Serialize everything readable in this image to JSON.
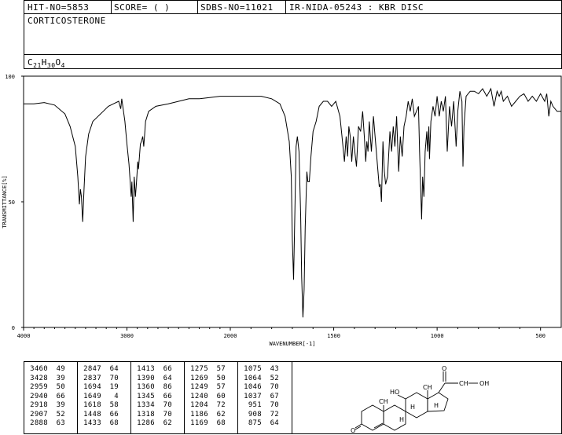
{
  "header": {
    "hit_no": "HIT-NO=5853",
    "score": "SCORE=  (   )",
    "sdbs_no": "SDBS-NO=11021",
    "source": "IR-NIDA-05243 : KBR DISC"
  },
  "compound": {
    "name": "CORTICOSTERONE",
    "formula_parts": {
      "C": "C",
      "c_sub": "21",
      "H": "H",
      "h_sub": "30",
      "O": "O",
      "o_sub": "4"
    }
  },
  "chart_data": {
    "type": "line",
    "xlabel": "WAVENUMBER[-1]",
    "ylabel": "TRANSMITTANCE[%]",
    "xlim": [
      4000,
      400
    ],
    "ylim": [
      0,
      100
    ],
    "x_ticks": [
      4000,
      3000,
      2000,
      1500,
      1000,
      500
    ],
    "y_ticks": [
      0,
      50,
      100
    ],
    "series": [
      {
        "points": [
          [
            4000,
            89
          ],
          [
            3900,
            89
          ],
          [
            3800,
            89.5
          ],
          [
            3700,
            88.5
          ],
          [
            3600,
            85
          ],
          [
            3550,
            80
          ],
          [
            3500,
            72
          ],
          [
            3475,
            60
          ],
          [
            3460,
            49
          ],
          [
            3450,
            55
          ],
          [
            3440,
            52
          ],
          [
            3428,
            42
          ],
          [
            3415,
            55
          ],
          [
            3400,
            68
          ],
          [
            3370,
            77
          ],
          [
            3330,
            82
          ],
          [
            3280,
            84
          ],
          [
            3230,
            86
          ],
          [
            3180,
            88
          ],
          [
            3130,
            89
          ],
          [
            3080,
            90
          ],
          [
            3060,
            87
          ],
          [
            3050,
            91
          ],
          [
            3020,
            82
          ],
          [
            3000,
            73
          ],
          [
            2980,
            65
          ],
          [
            2959,
            52
          ],
          [
            2952,
            58
          ],
          [
            2940,
            42
          ],
          [
            2930,
            60
          ],
          [
            2918,
            52
          ],
          [
            2907,
            58
          ],
          [
            2895,
            66
          ],
          [
            2888,
            63
          ],
          [
            2870,
            73
          ],
          [
            2860,
            74
          ],
          [
            2847,
            76
          ],
          [
            2837,
            72
          ],
          [
            2820,
            82
          ],
          [
            2790,
            86
          ],
          [
            2720,
            88
          ],
          [
            2600,
            89
          ],
          [
            2500,
            90
          ],
          [
            2400,
            91
          ],
          [
            2300,
            91
          ],
          [
            2200,
            91.5
          ],
          [
            2100,
            92
          ],
          [
            2000,
            92
          ],
          [
            1900,
            92
          ],
          [
            1850,
            92
          ],
          [
            1800,
            91
          ],
          [
            1760,
            89
          ],
          [
            1735,
            84
          ],
          [
            1715,
            74
          ],
          [
            1705,
            60
          ],
          [
            1700,
            35
          ],
          [
            1694,
            19
          ],
          [
            1688,
            45
          ],
          [
            1682,
            72
          ],
          [
            1676,
            76
          ],
          [
            1668,
            70
          ],
          [
            1660,
            45
          ],
          [
            1655,
            20
          ],
          [
            1649,
            4
          ],
          [
            1643,
            15
          ],
          [
            1638,
            40
          ],
          [
            1630,
            62
          ],
          [
            1625,
            58
          ],
          [
            1618,
            58
          ],
          [
            1610,
            68
          ],
          [
            1600,
            78
          ],
          [
            1585,
            82
          ],
          [
            1570,
            88
          ],
          [
            1550,
            90
          ],
          [
            1530,
            90
          ],
          [
            1510,
            88
          ],
          [
            1490,
            90
          ],
          [
            1470,
            84
          ],
          [
            1460,
            76
          ],
          [
            1448,
            66
          ],
          [
            1440,
            76
          ],
          [
            1433,
            68
          ],
          [
            1427,
            80
          ],
          [
            1420,
            76
          ],
          [
            1413,
            66
          ],
          [
            1405,
            76
          ],
          [
            1398,
            70
          ],
          [
            1390,
            64
          ],
          [
            1380,
            80
          ],
          [
            1370,
            78
          ],
          [
            1360,
            86
          ],
          [
            1352,
            76
          ],
          [
            1345,
            66
          ],
          [
            1340,
            74
          ],
          [
            1334,
            70
          ],
          [
            1328,
            82
          ],
          [
            1318,
            70
          ],
          [
            1308,
            84
          ],
          [
            1300,
            76
          ],
          [
            1286,
            62
          ],
          [
            1280,
            56
          ],
          [
            1275,
            57
          ],
          [
            1269,
            50
          ],
          [
            1262,
            74
          ],
          [
            1255,
            62
          ],
          [
            1249,
            57
          ],
          [
            1240,
            60
          ],
          [
            1228,
            78
          ],
          [
            1220,
            70
          ],
          [
            1212,
            80
          ],
          [
            1204,
            72
          ],
          [
            1196,
            84
          ],
          [
            1186,
            62
          ],
          [
            1178,
            76
          ],
          [
            1169,
            68
          ],
          [
            1160,
            80
          ],
          [
            1150,
            84
          ],
          [
            1140,
            90
          ],
          [
            1130,
            86
          ],
          [
            1120,
            91
          ],
          [
            1110,
            84
          ],
          [
            1100,
            86
          ],
          [
            1090,
            88
          ],
          [
            1085,
            70
          ],
          [
            1075,
            43
          ],
          [
            1070,
            60
          ],
          [
            1064,
            52
          ],
          [
            1058,
            70
          ],
          [
            1050,
            78
          ],
          [
            1046,
            70
          ],
          [
            1040,
            80
          ],
          [
            1037,
            67
          ],
          [
            1030,
            82
          ],
          [
            1020,
            88
          ],
          [
            1010,
            84
          ],
          [
            1000,
            92
          ],
          [
            990,
            84
          ],
          [
            980,
            90
          ],
          [
            970,
            86
          ],
          [
            960,
            92
          ],
          [
            951,
            70
          ],
          [
            940,
            88
          ],
          [
            930,
            80
          ],
          [
            920,
            90
          ],
          [
            908,
            72
          ],
          [
            900,
            86
          ],
          [
            890,
            94
          ],
          [
            880,
            90
          ],
          [
            875,
            64
          ],
          [
            870,
            80
          ],
          [
            860,
            92
          ],
          [
            840,
            94
          ],
          [
            820,
            94
          ],
          [
            800,
            93
          ],
          [
            780,
            95
          ],
          [
            760,
            92
          ],
          [
            740,
            95
          ],
          [
            725,
            88
          ],
          [
            710,
            94
          ],
          [
            700,
            92
          ],
          [
            690,
            94
          ],
          [
            680,
            90
          ],
          [
            660,
            92
          ],
          [
            640,
            88
          ],
          [
            620,
            90
          ],
          [
            600,
            92
          ],
          [
            580,
            93
          ],
          [
            560,
            90
          ],
          [
            540,
            92
          ],
          [
            520,
            90
          ],
          [
            500,
            93
          ],
          [
            480,
            90
          ],
          [
            470,
            93
          ],
          [
            460,
            84
          ],
          [
            450,
            90
          ],
          [
            440,
            88
          ],
          [
            420,
            86
          ],
          [
            400,
            86
          ]
        ]
      }
    ]
  },
  "peak_table": [
    [
      [
        "3460",
        "49"
      ],
      [
        "3428",
        "39"
      ],
      [
        "2959",
        "50"
      ],
      [
        "2940",
        "66"
      ],
      [
        "2918",
        "39"
      ],
      [
        "2907",
        "52"
      ],
      [
        "2888",
        "63"
      ]
    ],
    [
      [
        "2847",
        "64"
      ],
      [
        "2837",
        "70"
      ],
      [
        "1694",
        "19"
      ],
      [
        "1649",
        "4"
      ],
      [
        "1618",
        "58"
      ],
      [
        "1448",
        "66"
      ],
      [
        "1433",
        "68"
      ]
    ],
    [
      [
        "1413",
        "66"
      ],
      [
        "1390",
        "64"
      ],
      [
        "1360",
        "86"
      ],
      [
        "1345",
        "66"
      ],
      [
        "1334",
        "70"
      ],
      [
        "1318",
        "70"
      ],
      [
        "1286",
        "62"
      ]
    ],
    [
      [
        "1275",
        "57"
      ],
      [
        "1269",
        "50"
      ],
      [
        "1249",
        "57"
      ],
      [
        "1240",
        "60"
      ],
      [
        "1204",
        "72"
      ],
      [
        "1186",
        "62"
      ],
      [
        "1169",
        "68"
      ]
    ],
    [
      [
        "1075",
        "43"
      ],
      [
        "1064",
        "52"
      ],
      [
        "1046",
        "70"
      ],
      [
        "1037",
        "67"
      ],
      [
        "951",
        "70"
      ],
      [
        "908",
        "72"
      ],
      [
        "875",
        "64"
      ]
    ]
  ],
  "structure": {
    "labels": {
      "ho": "HO",
      "oh": "OH",
      "o_ketone": "O",
      "o_side": "O",
      "ch3_a": "CH",
      "ch3_b": "CH",
      "ch2": "CH",
      "h1": "H",
      "h2": "H",
      "h3": "H"
    }
  }
}
